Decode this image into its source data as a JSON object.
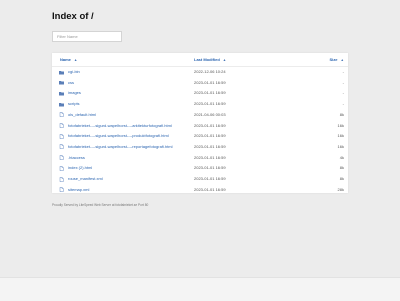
{
  "page": {
    "title": "Index of /",
    "filter_placeholder": "Filter Name"
  },
  "table": {
    "headers": {
      "name": "Name",
      "name_arrow": "▲",
      "modified": "Last Modified",
      "modified_arrow": "▲",
      "size": "Size",
      "size_arrow": "▲"
    },
    "rows": [
      {
        "type": "folder",
        "name": "cgi-bin",
        "modified": "2022-12-06 10:24",
        "size": "-"
      },
      {
        "type": "folder",
        "name": "css",
        "modified": "2023-01-01 16:59",
        "size": "-"
      },
      {
        "type": "folder",
        "name": "images",
        "modified": "2023-01-01 16:59",
        "size": "-"
      },
      {
        "type": "folder",
        "name": "scripts",
        "modified": "2023-01-01 16:59",
        "size": "-"
      },
      {
        "type": "file",
        "name": "ols_default.html",
        "modified": "2021-04-06 00:03",
        "size": "8k"
      },
      {
        "type": "file",
        "name": "fotofabrieket----sigurd-wapelhorst----arkitekturfotografi.html",
        "modified": "2023-01-01 16:59",
        "size": "16k"
      },
      {
        "type": "file",
        "name": "fotofabrieket----sigurd-wapelhorst----produktfotografi.html",
        "modified": "2023-01-01 16:59",
        "size": "16k"
      },
      {
        "type": "file",
        "name": "fotofabrieket----sigurd-wapelhorst----reportagefotografi.html",
        "modified": "2023-01-01 16:59",
        "size": "16k"
      },
      {
        "type": "file",
        "name": ".htaccess",
        "modified": "2023-01-01 16:59",
        "size": "4k"
      },
      {
        "type": "file",
        "name": "index (2).html",
        "modified": "2023-01-01 16:59",
        "size": "8k"
      },
      {
        "type": "file",
        "name": "rouse_manifest.xml",
        "modified": "2023-01-01 16:59",
        "size": "8k"
      },
      {
        "type": "file",
        "name": "sitemap.xml",
        "modified": "2023-01-01 16:59",
        "size": "28k"
      }
    ]
  },
  "footer": {
    "text": "Proudly Served by LiteSpeed Web Server at fotofabrieket.se Port 80"
  },
  "colors": {
    "link": "#2a64b0",
    "folder_icon": "#5b7fb8",
    "file_icon": "#6d8fc4",
    "background": "#ececec"
  }
}
